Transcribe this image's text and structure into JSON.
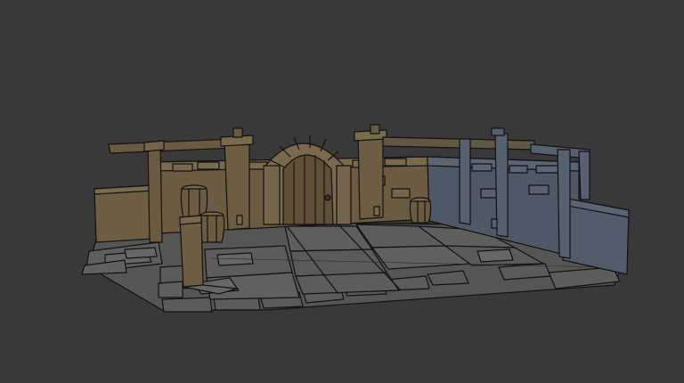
{
  "scene": {
    "description_visible_text": "",
    "background_color": "#393939",
    "palette": {
      "wall_warm": "#6d5d43",
      "wall_warm_light": "#7a6a4d",
      "wall_cool": "#4e5866",
      "wall_cool_light": "#5a6473",
      "floor": "#575757",
      "floor_light": "#656565",
      "wood": "#6a5a40",
      "outline": "#111111"
    },
    "objects": [
      "dungeon-floor-icon",
      "left-wall-icon",
      "right-wall-icon",
      "arched-door-icon",
      "barrel-icon",
      "wooden-beam-icon",
      "stone-pillar-icon"
    ]
  }
}
